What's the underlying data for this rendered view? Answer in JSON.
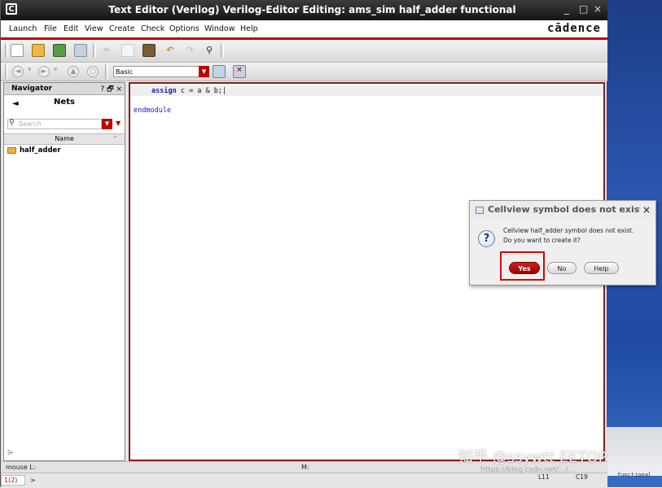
{
  "window": {
    "title": "Text Editor (Verilog) Verilog-Editor Editing: ams_sim half_adder functional",
    "app_icon": "C",
    "controls": [
      "_",
      "□",
      "×"
    ]
  },
  "menubar": {
    "items": [
      "Launch",
      "File",
      "Edit",
      "View",
      "Create",
      "Check",
      "Options",
      "Window",
      "Help"
    ],
    "brand": "cādence"
  },
  "toolbar2": {
    "combo_value": "Basic"
  },
  "navigator": {
    "title": "Navigator",
    "controls": "? 🗗 ×",
    "back_arrow": "◄",
    "section": "Nets",
    "search_placeholder": "Search",
    "column_header": "Name",
    "items": [
      "half_adder"
    ]
  },
  "editor": {
    "line1": {
      "keyword": "assign",
      "rest": " c = a & b;"
    },
    "line2": "endmodule"
  },
  "dialog": {
    "title": "Cellview symbol does not exist",
    "close": "×",
    "message_line1": "Cellview half_adder symbol does not exist.",
    "message_line2": "Do you want to create it?",
    "question_glyph": "?",
    "yes": "Yes",
    "no": "No",
    "help": "Help"
  },
  "status": {
    "mouse_l": "mouse L:",
    "mouse_m": "M:",
    "cmd_index": "1(2)",
    "prompt": ">",
    "line": "L11",
    "col": "C19"
  },
  "watermark": {
    "main": "知乎 @ssywtt EETOP",
    "url": "https://blog.csdn.net/.../...",
    "corner": "functional"
  },
  "colors": {
    "accent": "#c00000",
    "title_bg": "#222222",
    "code": "#1a1ab0"
  }
}
